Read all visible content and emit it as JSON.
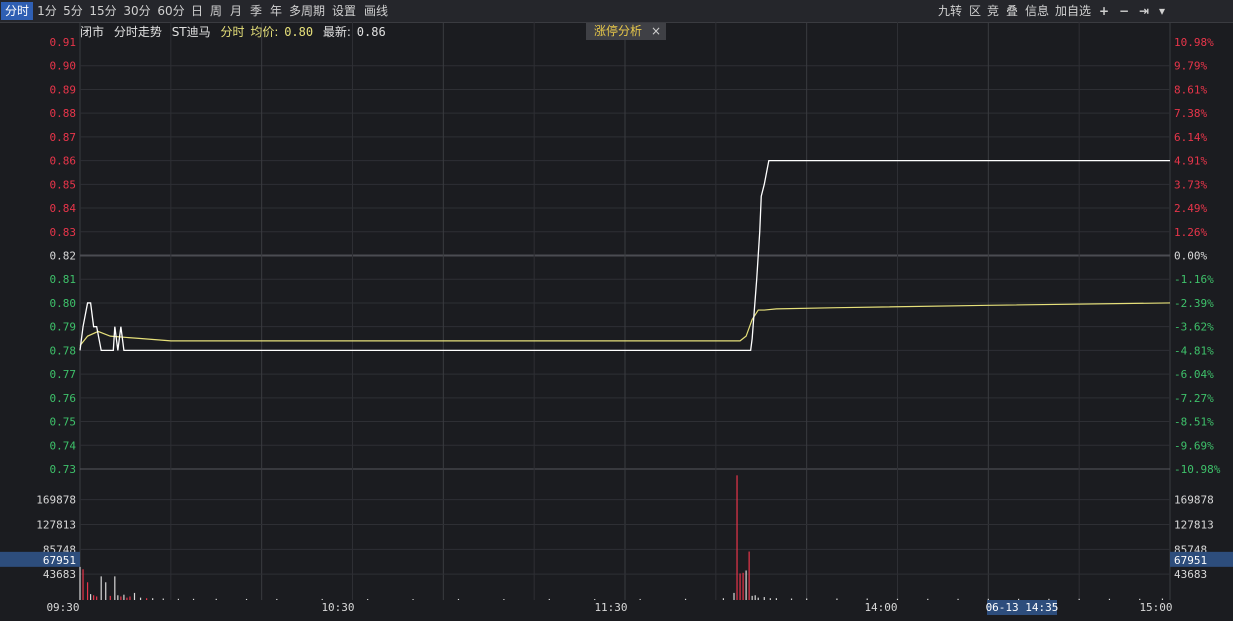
{
  "toolbar": {
    "periods": [
      "分时",
      "1分",
      "5分",
      "15分",
      "30分",
      "60分",
      "日",
      "周",
      "月",
      "季",
      "年",
      "多周期",
      "设置",
      "画线"
    ],
    "active_period": "分时",
    "right_items": [
      "九转",
      "区",
      "竞",
      "叠",
      "信息",
      "加自选",
      "+",
      "−",
      "⇥",
      "▾"
    ]
  },
  "info_bar": {
    "status": "闭市",
    "mode": "分时走势",
    "stock": "ST迪马",
    "sub_mode": "分时",
    "avg_label": "均价:",
    "avg_value": "0.80",
    "last_label": "最新:",
    "last_value": "0.86"
  },
  "analysis_tab": {
    "label": "涨停分析",
    "close": "×"
  },
  "colors": {
    "up": "#e8354a",
    "down": "#3ec16a",
    "neutral": "#d8d8d8",
    "price_line": "#ffffff",
    "avg_line": "#e6e07a",
    "grid": "#2e2f34",
    "volume_highlight": "#2d4d7c"
  },
  "chart_data": {
    "type": "line",
    "prev_close": 0.82,
    "price_axis": {
      "ticks": [
        "0.91",
        "0.90",
        "0.89",
        "0.88",
        "0.87",
        "0.86",
        "0.85",
        "0.84",
        "0.83",
        "0.82",
        "0.81",
        "0.80",
        "0.79",
        "0.78",
        "0.77",
        "0.76",
        "0.75",
        "0.74",
        "0.73"
      ],
      "ylim": [
        0.73,
        0.91
      ]
    },
    "pct_axis": {
      "ticks": [
        "10.98%",
        "9.79%",
        "8.61%",
        "7.38%",
        "6.14%",
        "4.91%",
        "3.73%",
        "2.49%",
        "1.26%",
        "0.00%",
        "-1.16%",
        "-2.39%",
        "-3.62%",
        "-4.81%",
        "-6.04%",
        "-7.27%",
        "-8.51%",
        "-9.69%",
        "-10.98%"
      ]
    },
    "volume_axis": {
      "ticks": [
        "169878",
        "127813",
        "85748",
        "43683"
      ],
      "highlight": "67951",
      "ylim": [
        0,
        220000
      ]
    },
    "x_ticks": [
      "09:30",
      "10:30",
      "11:30",
      "14:00",
      "15:00"
    ],
    "cursor_label": "06-13 14:35",
    "price_series": {
      "name": "",
      "x": [
        0,
        2,
        5,
        7,
        9,
        11,
        14,
        20,
        22,
        23,
        25,
        27,
        29,
        31,
        33,
        100,
        200,
        300,
        400,
        430,
        436,
        443,
        444,
        447,
        449,
        450,
        452,
        455,
        458,
        460,
        461,
        462,
        500,
        600,
        700,
        720
      ],
      "y": [
        0.78,
        0.79,
        0.8,
        0.8,
        0.79,
        0.79,
        0.78,
        0.78,
        0.78,
        0.79,
        0.78,
        0.79,
        0.78,
        0.78,
        0.78,
        0.78,
        0.78,
        0.78,
        0.78,
        0.78,
        0.78,
        0.78,
        0.785,
        0.81,
        0.83,
        0.845,
        0.85,
        0.86,
        0.86,
        0.86,
        0.86,
        0.86,
        0.86,
        0.86,
        0.86,
        0.86
      ]
    },
    "avg_series": {
      "name": "",
      "x": [
        0,
        5,
        12,
        20,
        40,
        60,
        100,
        200,
        300,
        400,
        430,
        436,
        440,
        444,
        448,
        452,
        460,
        500,
        600,
        720
      ],
      "y": [
        0.782,
        0.786,
        0.788,
        0.786,
        0.785,
        0.784,
        0.784,
        0.784,
        0.784,
        0.784,
        0.784,
        0.784,
        0.786,
        0.793,
        0.797,
        0.797,
        0.7975,
        0.798,
        0.799,
        0.8
      ]
    },
    "volume_series": {
      "x": [
        0,
        2,
        5,
        7,
        9,
        11,
        14,
        17,
        20,
        23,
        25,
        27,
        29,
        31,
        33,
        36,
        40,
        44,
        48,
        55,
        65,
        75,
        90,
        110,
        130,
        160,
        190,
        220,
        250,
        280,
        310,
        340,
        370,
        400,
        425,
        432,
        434,
        436,
        438,
        440,
        442,
        444,
        446,
        448,
        452,
        456,
        460,
        470,
        480,
        500,
        520,
        540,
        560,
        580,
        600,
        620,
        640,
        660,
        680,
        700,
        715
      ],
      "v": [
        56000,
        52000,
        30000,
        10000,
        8000,
        6000,
        40000,
        30000,
        7000,
        40000,
        8000,
        6000,
        9000,
        4000,
        6000,
        12000,
        4000,
        3000,
        3000,
        2500,
        2000,
        2000,
        2000,
        1800,
        1800,
        1800,
        1600,
        1600,
        1800,
        1600,
        1800,
        1600,
        1800,
        2000,
        3000,
        12000,
        211000,
        45000,
        46000,
        50000,
        82000,
        7000,
        8000,
        4000,
        5000,
        3000,
        3000,
        2500,
        2500,
        2500,
        2500,
        2000,
        2000,
        2000,
        2000,
        2000,
        2000,
        2000,
        2000,
        2000,
        2500
      ],
      "up": [
        false,
        true,
        true,
        false,
        true,
        true,
        false,
        false,
        true,
        false,
        false,
        true,
        false,
        true,
        true,
        false,
        false,
        true,
        false,
        false,
        false,
        false,
        false,
        false,
        false,
        false,
        false,
        false,
        false,
        false,
        false,
        false,
        false,
        false,
        false,
        false,
        true,
        true,
        true,
        false,
        true,
        false,
        false,
        false,
        false,
        false,
        false,
        false,
        false,
        false,
        false,
        false,
        false,
        false,
        false,
        false,
        false,
        false,
        false,
        false,
        false
      ]
    }
  }
}
